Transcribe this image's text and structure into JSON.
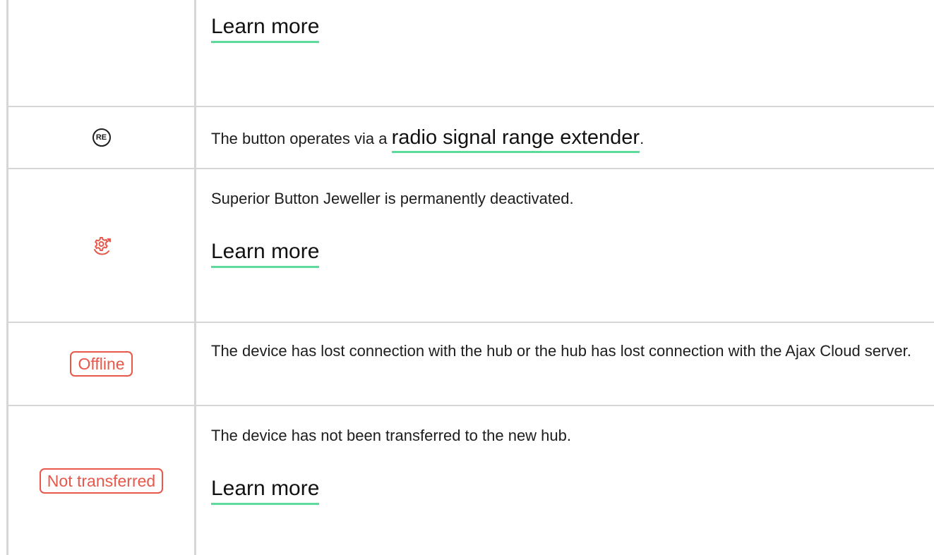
{
  "rows": [
    {
      "learn_more": "Learn more"
    },
    {
      "icon": "RE",
      "icon_name": "range-extender-icon",
      "text_before": "The button operates via a ",
      "link": "radio signal range extender",
      "text_after": "."
    },
    {
      "icon_name": "deactivated-gear-icon",
      "text": "Superior Button Jeweller is permanently deactivated.",
      "learn_more": "Learn more"
    },
    {
      "badge": "Offline",
      "text": "The device has lost connection with the hub or the hub has lost connection with the Ajax Cloud server."
    },
    {
      "badge": "Not transferred",
      "text": "The device has not been transferred to the new hub.",
      "learn_more": "Learn more"
    }
  ],
  "colors": {
    "accent_underline": "#5cdb9d",
    "alert_red": "#e8574a",
    "border": "#d6d6d6"
  }
}
